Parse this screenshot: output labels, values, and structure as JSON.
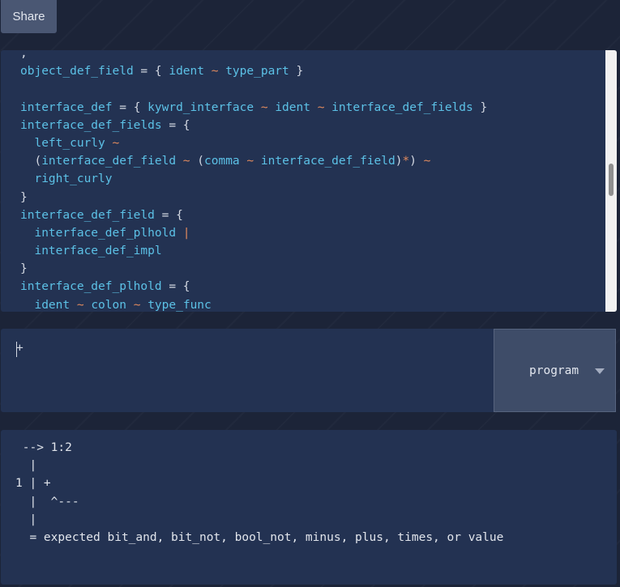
{
  "toolbar": {
    "share_label": "Share"
  },
  "editor": {
    "lines": [
      [
        {
          "t": ",",
          "k": "punct"
        }
      ],
      [
        {
          "t": "object_def_field",
          "k": "ident"
        },
        {
          "t": " = { ",
          "k": "punct"
        },
        {
          "t": "ident",
          "k": "ident"
        },
        {
          "t": " ~ ",
          "k": "op"
        },
        {
          "t": "type_part",
          "k": "ident"
        },
        {
          "t": " }",
          "k": "punct"
        }
      ],
      [],
      [
        {
          "t": "interface_def",
          "k": "ident"
        },
        {
          "t": " = { ",
          "k": "punct"
        },
        {
          "t": "kywrd_interface",
          "k": "ident"
        },
        {
          "t": " ~ ",
          "k": "op"
        },
        {
          "t": "ident",
          "k": "ident"
        },
        {
          "t": " ~ ",
          "k": "op"
        },
        {
          "t": "interface_def_fields",
          "k": "ident"
        },
        {
          "t": " }",
          "k": "punct"
        }
      ],
      [
        {
          "t": "interface_def_fields",
          "k": "ident"
        },
        {
          "t": " = {",
          "k": "punct"
        }
      ],
      [
        {
          "t": "  ",
          "k": "punct"
        },
        {
          "t": "left_curly",
          "k": "ident"
        },
        {
          "t": " ~",
          "k": "op"
        }
      ],
      [
        {
          "t": "  (",
          "k": "punct"
        },
        {
          "t": "interface_def_field",
          "k": "ident"
        },
        {
          "t": " ~ ",
          "k": "op"
        },
        {
          "t": "(",
          "k": "punct"
        },
        {
          "t": "comma",
          "k": "ident"
        },
        {
          "t": " ~ ",
          "k": "op"
        },
        {
          "t": "interface_def_field",
          "k": "ident"
        },
        {
          "t": ")",
          "k": "punct"
        },
        {
          "t": "*",
          "k": "op"
        },
        {
          "t": ")",
          "k": "punct"
        },
        {
          "t": " ~",
          "k": "op"
        }
      ],
      [
        {
          "t": "  ",
          "k": "punct"
        },
        {
          "t": "right_curly",
          "k": "ident"
        }
      ],
      [
        {
          "t": "}",
          "k": "punct"
        }
      ],
      [
        {
          "t": "interface_def_field",
          "k": "ident"
        },
        {
          "t": " = {",
          "k": "punct"
        }
      ],
      [
        {
          "t": "  ",
          "k": "punct"
        },
        {
          "t": "interface_def_plhold",
          "k": "ident"
        },
        {
          "t": " |",
          "k": "op"
        }
      ],
      [
        {
          "t": "  ",
          "k": "punct"
        },
        {
          "t": "interface_def_impl",
          "k": "ident"
        }
      ],
      [
        {
          "t": "}",
          "k": "punct"
        }
      ],
      [
        {
          "t": "interface_def_plhold",
          "k": "ident"
        },
        {
          "t": " = {",
          "k": "punct"
        }
      ],
      [
        {
          "t": "  ",
          "k": "punct"
        },
        {
          "t": "ident",
          "k": "ident"
        },
        {
          "t": " ~ ",
          "k": "op"
        },
        {
          "t": "colon",
          "k": "ident"
        },
        {
          "t": " ~ ",
          "k": "op"
        },
        {
          "t": "type_func",
          "k": "ident"
        }
      ]
    ]
  },
  "input": {
    "value": "+"
  },
  "rule_select": {
    "selected": "program"
  },
  "output": {
    "lines": [
      " --> 1:2",
      "  |",
      "1 | +",
      "  |  ^---",
      "  |",
      "  = expected bit_and, bit_not, bool_not, minus, plus, times, or value"
    ]
  },
  "colors": {
    "identifier": "#5cc1e6",
    "operator": "#e08a5e",
    "text": "#d3d8e2",
    "panel": "#233252",
    "background": "#1c2438"
  }
}
